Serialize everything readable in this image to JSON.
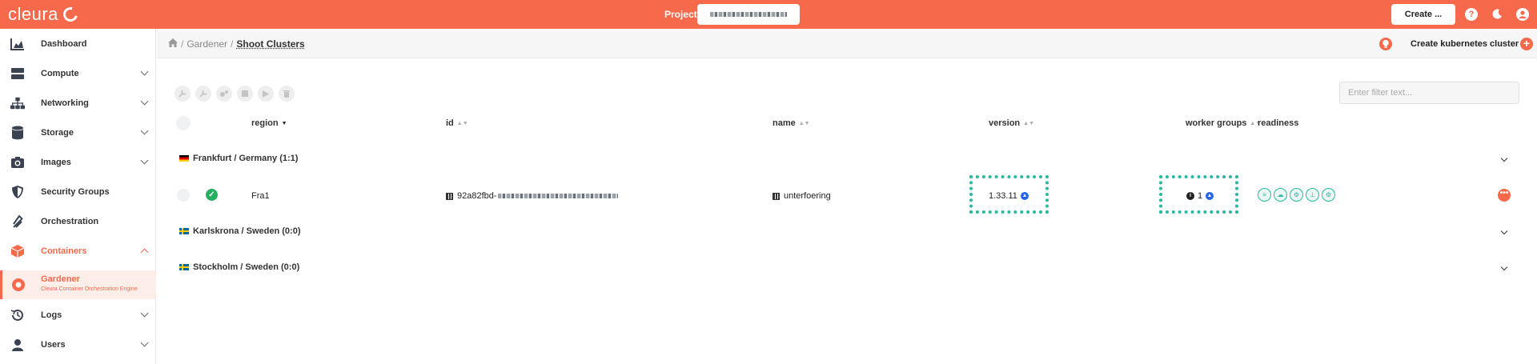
{
  "topbar": {
    "brand": "cleura",
    "project_label": "Project",
    "create_label": "Create ..."
  },
  "sidebar": {
    "items": [
      {
        "label": "Dashboard",
        "icon": "chart-area-icon",
        "expandable": false
      },
      {
        "label": "Compute",
        "icon": "server-icon",
        "expandable": true
      },
      {
        "label": "Networking",
        "icon": "sitemap-icon",
        "expandable": true
      },
      {
        "label": "Storage",
        "icon": "database-icon",
        "expandable": true
      },
      {
        "label": "Images",
        "icon": "camera-icon",
        "expandable": true
      },
      {
        "label": "Security Groups",
        "icon": "shield-icon",
        "expandable": false
      },
      {
        "label": "Orchestration",
        "icon": "orchestration-icon",
        "expandable": false
      },
      {
        "label": "Containers",
        "icon": "cube-icon",
        "expandable": true
      },
      {
        "label": "Logs",
        "icon": "history-icon",
        "expandable": true
      },
      {
        "label": "Users",
        "icon": "user-icon",
        "expandable": true
      }
    ],
    "sub_item": {
      "title": "Gardener",
      "desc": "Cleura Container Orchestration Engine"
    }
  },
  "breadcrumb": {
    "home_icon": "home-icon",
    "parent": "Gardener",
    "sep": "/",
    "current": "Shoot Clusters"
  },
  "header": {
    "create_k8s": "Create kubernetes cluster"
  },
  "toolbar": {
    "icons": [
      "wrench-icon",
      "wrench-alt-icon",
      "cogs-icon",
      "stop-icon",
      "play-icon",
      "trash-icon"
    ]
  },
  "filter": {
    "placeholder": "Enter filter text..."
  },
  "table": {
    "headers": {
      "region": "region",
      "id": "id",
      "name": "name",
      "version": "version",
      "worker_groups": "worker groups",
      "readiness": "readiness"
    },
    "groups": [
      {
        "label": "Frankfurt / Germany (1:1)",
        "flag": "de"
      },
      {
        "label": "Karlskrona / Sweden (0:0)",
        "flag": "se"
      },
      {
        "label": "Stockholm / Sweden (0:0)",
        "flag": "se"
      }
    ],
    "row": {
      "region": "Fra1",
      "id": "92a82fbd-",
      "name": "unterfoering",
      "version": "1.33.11",
      "worker_groups": "1"
    },
    "readiness_icons": [
      "list-icon",
      "cloud-icon",
      "cogs-icon",
      "sitemap-icon",
      "cogs-icon"
    ],
    "more_label": "•••"
  },
  "colors": {
    "accent": "#f7694b",
    "highlight": "#2bb8a0",
    "ok": "#27ae60"
  }
}
